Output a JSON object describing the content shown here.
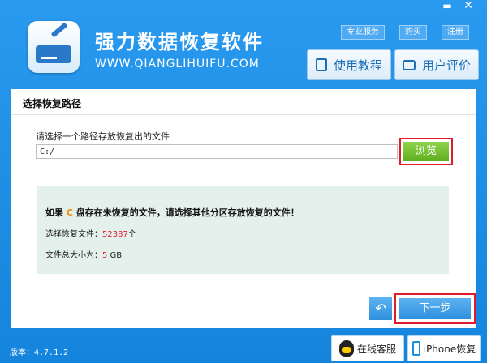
{
  "window": {
    "minimize_glyph": "▬",
    "close_glyph": "✕"
  },
  "header": {
    "title": "强力数据恢复软件",
    "url": "WWW.QIANGLIHUIFU.COM",
    "links": [
      "专业服务",
      "购买",
      "注册"
    ],
    "tutorial_label": "使用教程",
    "review_label": "用户评价"
  },
  "main": {
    "section_title": "选择恢复路径",
    "path_label": "请选择一个路径存放恢复出的文件",
    "path_value": "C:/",
    "browse_label": "浏览",
    "warning_pre": "如果 ",
    "warning_drive": "C",
    "warning_post": " 盘存在未恢复的文件，请选择其他分区存放恢复的文件！",
    "files_label": "选择恢复文件：",
    "files_count": "52387",
    "files_unit": "个",
    "size_label": "文件总大小为：",
    "size_value": "5",
    "size_unit": " GB",
    "back_glyph": "↶",
    "next_label": "下一步"
  },
  "footer": {
    "version": "版本：4.7.1.2",
    "online_service": "在线客服",
    "iphone_recovery": "iPhone恢复"
  },
  "colors": {
    "accent": "#1a8ee0",
    "highlight_border": "#e21b2c",
    "browse_green": "#6fbf2a",
    "drive_orange": "#f08a00"
  }
}
